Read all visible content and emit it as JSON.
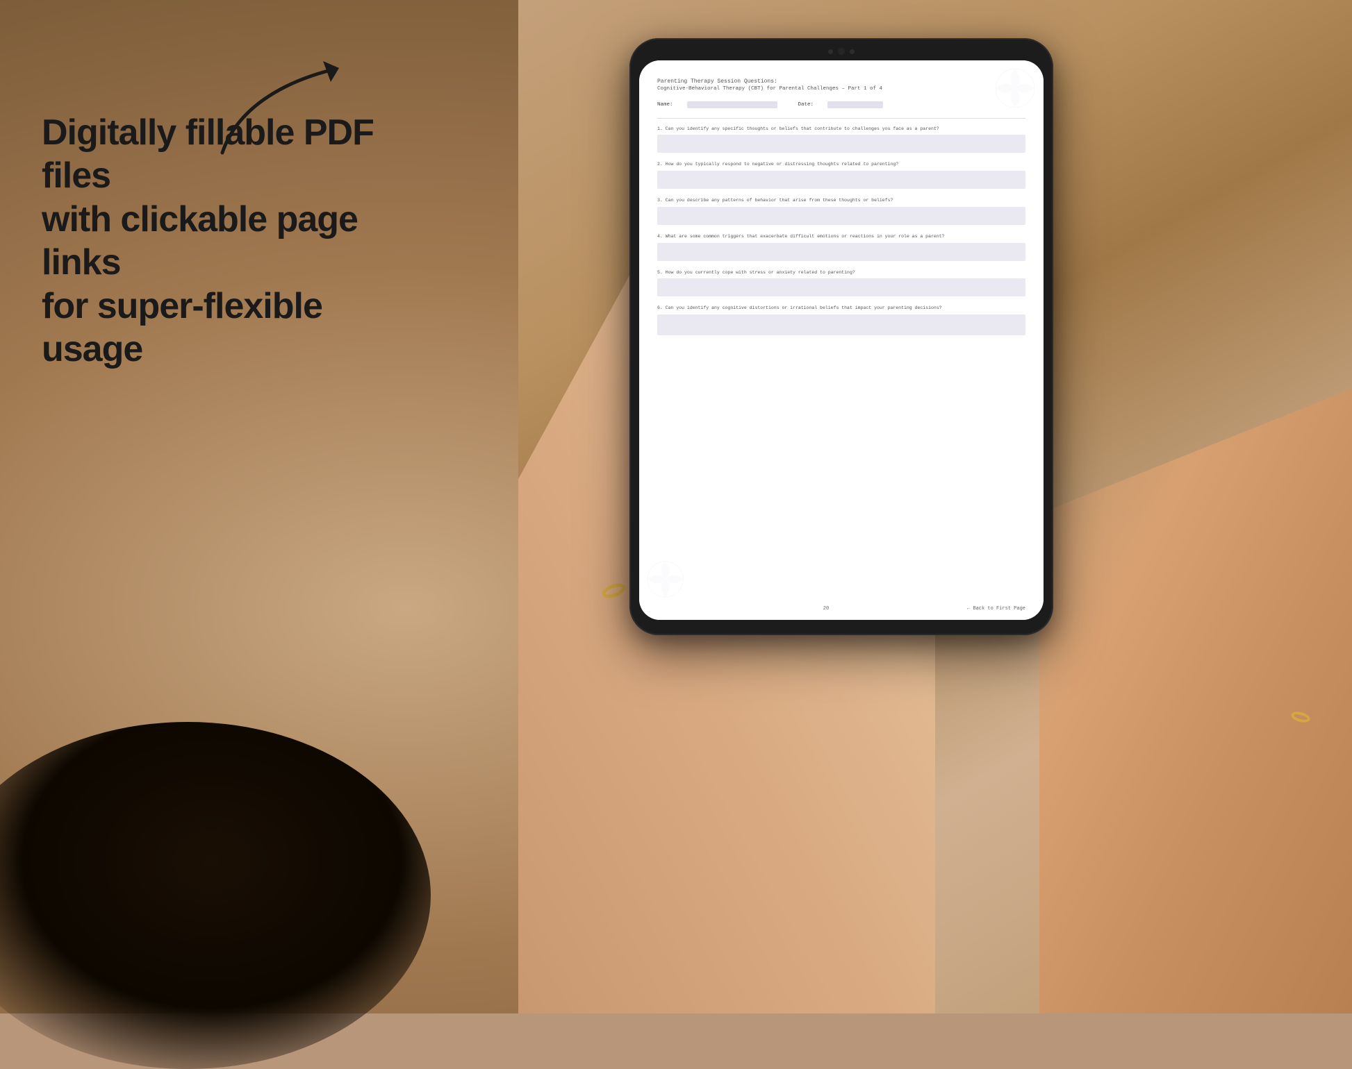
{
  "background": {
    "color": "#b8967a"
  },
  "promo": {
    "line1": "Digitally fillable PDF files",
    "line2": "with clickable page links",
    "line3": "for super-flexible usage"
  },
  "pdf": {
    "title_line1": "Parenting Therapy Session Questions:",
    "title_line2": "Cognitive-Behavioral Therapy (CBT) for Parental Challenges – Part 1 of 4",
    "name_label": "Name:",
    "date_label": "Date:",
    "questions": [
      {
        "number": "1.",
        "text": "Can you identify any specific thoughts or beliefs that contribute to challenges you face as a parent?"
      },
      {
        "number": "2.",
        "text": "How do you typically respond to negative or distressing thoughts related to parenting?"
      },
      {
        "number": "3.",
        "text": "Can you describe any patterns of behavior that arise from these thoughts or beliefs?"
      },
      {
        "number": "4.",
        "text": "What are some common triggers that exacerbate difficult emotions or reactions in your role as a parent?"
      },
      {
        "number": "5.",
        "text": "How do you currently cope with stress or anxiety related to parenting?"
      },
      {
        "number": "6.",
        "text": "Can you identify any cognitive distortions or irrational beliefs that impact your parenting decisions?"
      }
    ],
    "footer": {
      "page_number": "20",
      "back_link": "← Back to First Page"
    }
  }
}
